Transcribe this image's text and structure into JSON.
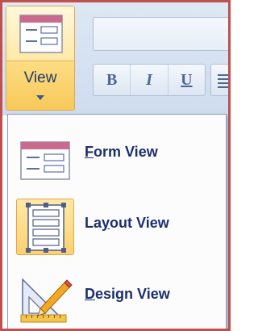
{
  "ribbon": {
    "view_label": "View",
    "format": {
      "bold": "B",
      "italic": "I",
      "underline": "U"
    }
  },
  "menu": {
    "items": [
      {
        "mnemonic": "F",
        "rest": "orm View"
      },
      {
        "pre": "La",
        "mnemonic": "y",
        "rest": "out View"
      },
      {
        "mnemonic": "D",
        "rest": "esign View"
      }
    ]
  },
  "colors": {
    "frame_border": "#c0504d",
    "highlight": "#fcd170",
    "label_text": "#1c2f6e"
  }
}
